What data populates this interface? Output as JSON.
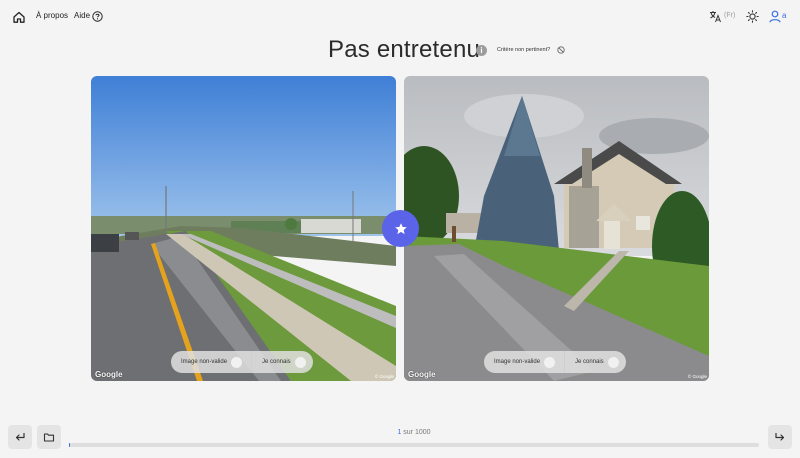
{
  "nav": {
    "about_label": "À propos",
    "help_label": "Aide",
    "lang_label": "(Fr)",
    "user_label": "a"
  },
  "page": {
    "title": "Pas entretenu",
    "criteria_label": "Critère non pertinent?"
  },
  "images": [
    {
      "scene": "highway with concrete barrier and grass median",
      "invalid_label": "Image non-valide",
      "know_label": "Je connais",
      "watermark": "Google",
      "credit": "© Google"
    },
    {
      "scene": "residential street with spruce tree and stone house",
      "invalid_label": "Image non-valide",
      "know_label": "Je connais",
      "watermark": "Google",
      "credit": "© Google"
    }
  ],
  "pagination": {
    "current": "1",
    "separator": "sur",
    "total": "1000",
    "progress_fraction": 0.001
  },
  "icons": {
    "home": "home-icon",
    "help": "question-circle-icon",
    "translate": "translate-icon",
    "theme": "sun-icon",
    "user": "user-icon",
    "info": "info-icon",
    "criteria": "not-relevant-icon",
    "favorite": "star-icon",
    "back": "undo-icon",
    "folder": "folder-icon",
    "next": "redo-icon"
  },
  "colors": {
    "accent": "#3b6fe0",
    "star_button": "#5b63e8",
    "background": "#f4f4f4"
  }
}
